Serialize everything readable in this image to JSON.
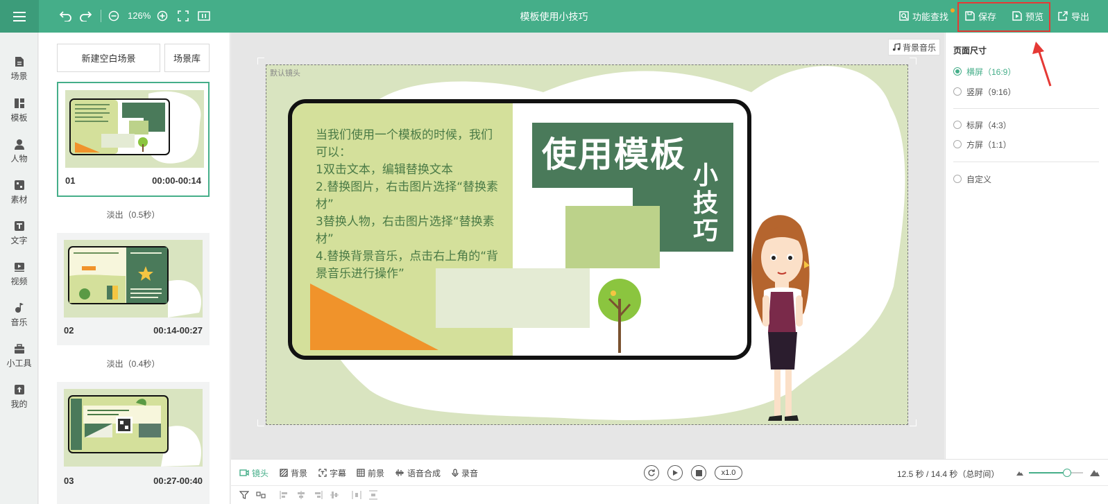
{
  "app": {
    "title": "模板使用小技巧",
    "zoom": "126%"
  },
  "toolbar": {
    "find_label": "功能查找",
    "save_label": "保存",
    "preview_label": "预览",
    "export_label": "导出"
  },
  "nav": {
    "items": [
      {
        "label": "场景",
        "icon": "scene-icon"
      },
      {
        "label": "模板",
        "icon": "template-icon"
      },
      {
        "label": "人物",
        "icon": "person-icon"
      },
      {
        "label": "素材",
        "icon": "material-icon"
      },
      {
        "label": "文字",
        "icon": "text-icon"
      },
      {
        "label": "视频",
        "icon": "video-icon"
      },
      {
        "label": "音乐",
        "icon": "music-icon"
      },
      {
        "label": "小工具",
        "icon": "toolbox-icon"
      },
      {
        "label": "我的",
        "icon": "upload-icon"
      }
    ]
  },
  "scenes": {
    "new_label": "新建空白场景",
    "library_label": "场景库",
    "items": [
      {
        "num": "01",
        "time": "00:00-00:14",
        "transition": "淡出（0.5秒）"
      },
      {
        "num": "02",
        "time": "00:14-00:27",
        "transition": "淡出（0.4秒）"
      },
      {
        "num": "03",
        "time": "00:27-00:40"
      }
    ]
  },
  "canvas": {
    "music_label": "背景音乐",
    "camera_label": "默认镜头",
    "text_lines": [
      "当我们使用一个模板的时候，我们",
      "可以：",
      "1双击文本，编辑替换文本",
      "2.替换图片，右击图片选择“替换素",
      "材”",
      "3替换人物，右击图片选择“替换素",
      "材”",
      "4.替换背景音乐，点击右上角的“背",
      "景音乐进行操作”"
    ],
    "title_main": "使用模板",
    "title_sub": "小技巧"
  },
  "right_panel": {
    "section_title": "页面尺寸",
    "options": [
      {
        "label": "横屏（16:9）",
        "checked": true
      },
      {
        "label": "竖屏（9:16）",
        "checked": false
      },
      {
        "label": "标屏（4:3）",
        "checked": false
      },
      {
        "label": "方屏（1:1）",
        "checked": false
      },
      {
        "label": "自定义",
        "checked": false
      }
    ]
  },
  "bottom": {
    "tabs": [
      "镜头",
      "背景",
      "字幕",
      "前景",
      "语音合成",
      "录音"
    ],
    "speed": "x1.0",
    "time_info": "12.5 秒 / 14.4 秒（总时间）",
    "zoom_level": 0.7
  },
  "colors": {
    "brand": "#45ae89",
    "highlight": "#e53935"
  }
}
